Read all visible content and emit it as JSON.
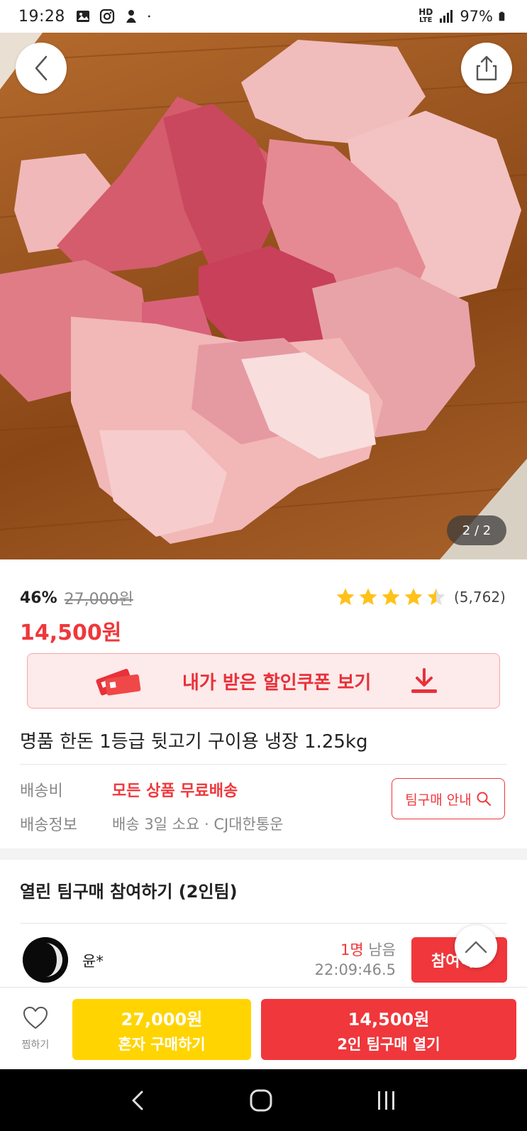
{
  "status_bar": {
    "time": "19:28",
    "network": "HD",
    "network_sub": "LTE",
    "battery": "97%"
  },
  "hero": {
    "page_indicator": "2 / 2",
    "current_page": 2,
    "total_pages": 2
  },
  "price": {
    "discount_percent": "46%",
    "original_price": "27,000원",
    "sale_price": "14,500원",
    "rating": 4.5,
    "review_count": "(5,762)"
  },
  "coupon": {
    "label": "내가 받은 할인쿠폰 보기"
  },
  "product": {
    "title": "명품 한돈 1등급 뒷고기 구이용 냉장 1.25kg"
  },
  "shipping": {
    "fee_label": "배송비",
    "fee_value": "모든 상품 무료배송",
    "info_label": "배송정보",
    "info_value": "배송 3일 소요 · CJ대한통운",
    "team_guide_button": "팀구매 안내"
  },
  "team_purchase": {
    "section_title": "열린 팀구매 참여하기 (2인팀)",
    "groups": [
      {
        "member_name": "윤*",
        "remaining_count": "1명",
        "remaining_suffix": " 남음",
        "countdown": "22:09:46.5",
        "join_label": "참여하"
      }
    ]
  },
  "bottom_bar": {
    "wish_label": "찜하기",
    "solo_price": "27,000원",
    "solo_label": "혼자 구매하기",
    "team_price": "14,500원",
    "team_label": "2인 팀구매 열기"
  },
  "colors": {
    "accent_red": "#f0373b",
    "solo_yellow": "#ffd400",
    "star_yellow": "#ffc21a"
  }
}
